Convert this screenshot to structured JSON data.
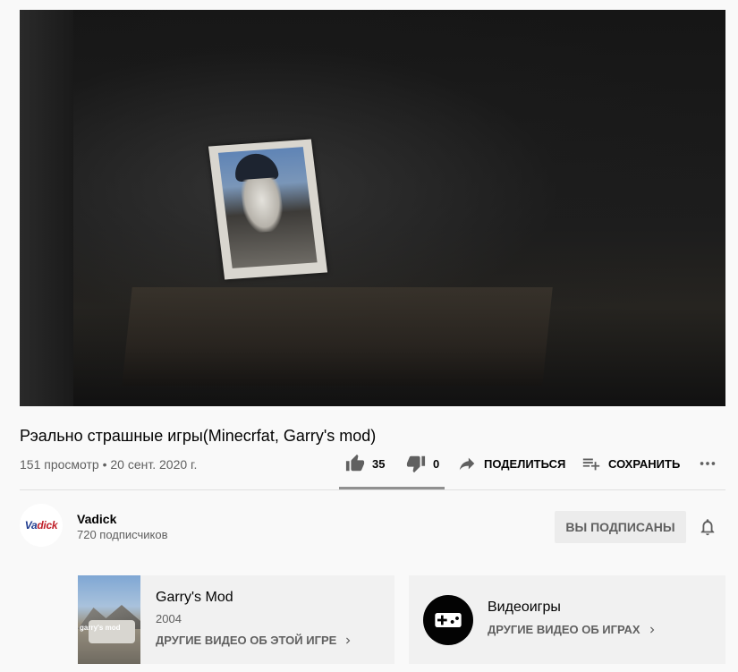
{
  "video": {
    "title": "Рэально страшные игры(Minecrfat, Garry's mod)",
    "views": "151 просмотр",
    "separator": "•",
    "date": "20 сент. 2020 г."
  },
  "actions": {
    "likes": "35",
    "dislikes": "0",
    "share_label": "ПОДЕЛИТЬСЯ",
    "save_label": "СОХРАНИТЬ"
  },
  "channel": {
    "name": "Vadick",
    "subscribers": "720 подписчиков",
    "subscribed_label": "ВЫ ПОДПИСАНЫ",
    "logo_text_main": "Va",
    "logo_text_accent": "dick"
  },
  "cards": [
    {
      "title": "Garry's Mod",
      "year": "2004",
      "link": "ДРУГИЕ ВИДЕО ОБ ЭТОЙ ИГРЕ",
      "thumb_text": "garry's mod"
    },
    {
      "title": "Видеоигры",
      "link": "ДРУГИЕ ВИДЕО ОБ ИГРАХ"
    }
  ],
  "icons": [
    "thumb-up-icon",
    "thumb-down-icon",
    "share-icon",
    "playlist-add-icon",
    "more-icon",
    "bell-icon",
    "chevron-right-icon",
    "gamepad-icon"
  ],
  "colors": {
    "text_primary": "#030303",
    "text_secondary": "#606060",
    "background": "#f9f9f9",
    "card_bg": "#f1f1f1"
  }
}
